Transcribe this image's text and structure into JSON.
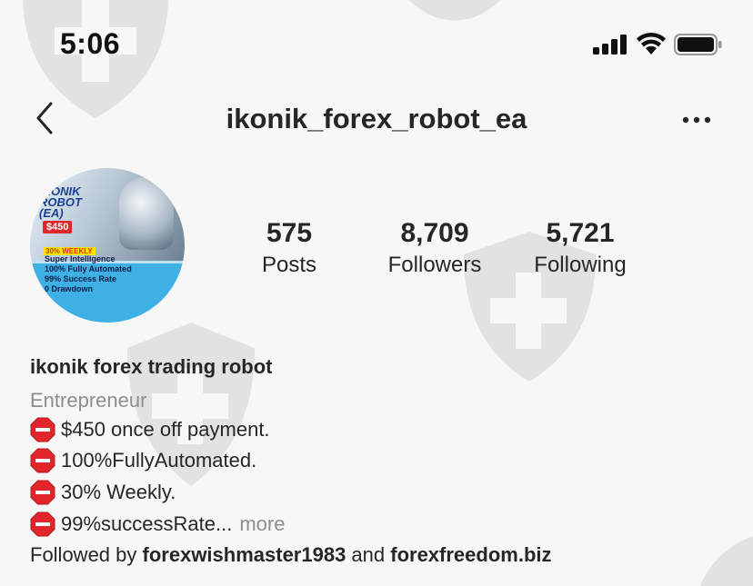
{
  "status_bar": {
    "time": "5:06"
  },
  "nav": {
    "username": "ikonik_forex_robot_ea"
  },
  "avatar": {
    "brand_line1": "IKONIK",
    "brand_line2": "ROBOT",
    "brand_line3": "(EA)",
    "price": "$450",
    "weekly": "30% WEEKLY",
    "bullets": [
      "Super Intelligence",
      "100% Fully Automated",
      "99% Success Rate",
      "0 Drawdown"
    ]
  },
  "stats": {
    "posts": {
      "value": "575",
      "label": "Posts"
    },
    "followers": {
      "value": "8,709",
      "label": "Followers"
    },
    "following": {
      "value": "5,721",
      "label": "Following"
    }
  },
  "bio": {
    "name": "ikonik forex trading robot",
    "category": "Entrepreneur",
    "lines": [
      "$450 once off payment.",
      "100%FullyAutomated.",
      "30% Weekly.",
      "99%successRate..."
    ],
    "more_label": "more",
    "followed_prefix": "Followed by ",
    "followed_user1": "forexwishmaster1983",
    "followed_and": " and ",
    "followed_user2": "forexfreedom.biz"
  },
  "colors": {
    "text": "#262626",
    "secondary": "#8e8e8e",
    "stop_sign": "#e0262b",
    "background": "#f7f7f7"
  }
}
